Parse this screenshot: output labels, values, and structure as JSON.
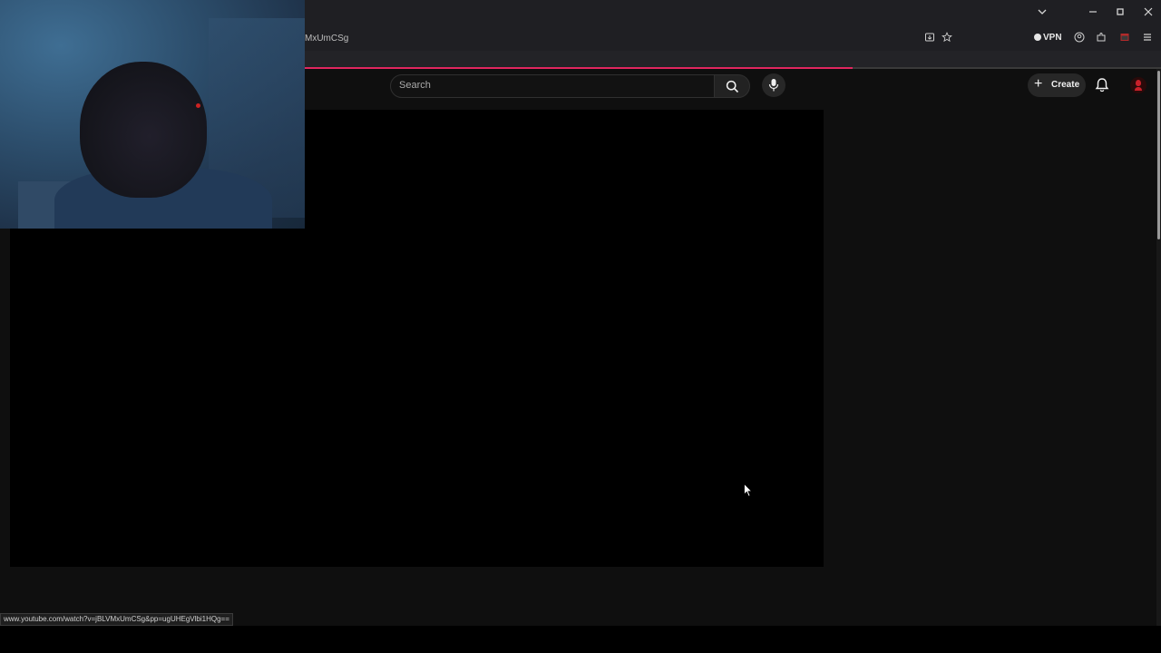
{
  "browser": {
    "url_partial": "MxUmCSg",
    "vpn_label": "VPN",
    "status_link": "www.youtube.com/watch?v=jBLVMxUmCSg&pp=ugUHEgVlbi1HQg==",
    "accent_color": "#e0265f",
    "window_controls": [
      "chevron-down-icon",
      "minimize-icon",
      "restore-icon",
      "close-icon"
    ],
    "toolbar_icons": [
      "install-icon",
      "bookmark-star-icon",
      "account-icon",
      "extensions-icon",
      "calendar-icon",
      "menu-icon"
    ]
  },
  "youtube": {
    "search_placeholder": "Search",
    "create_label": "Create",
    "icons": [
      "search-icon",
      "mic-icon",
      "plus-icon",
      "bell-icon",
      "avatar-icon"
    ]
  },
  "player": {
    "state": "black"
  }
}
